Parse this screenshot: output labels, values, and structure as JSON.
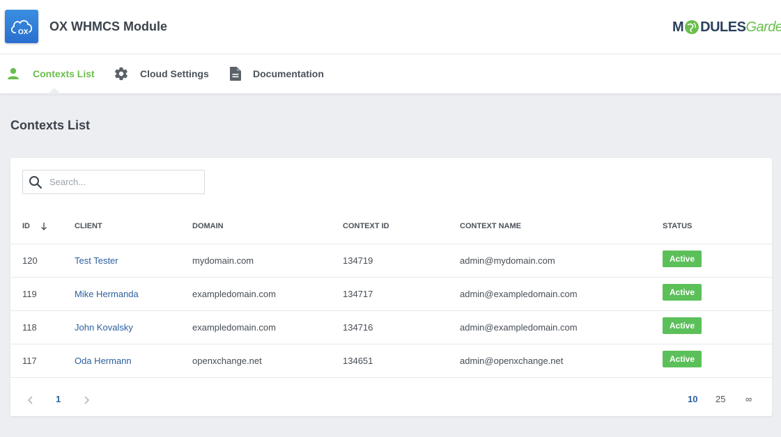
{
  "app": {
    "title": "OX WHMCS Module",
    "logo_text": "OX",
    "brand_part1": "M",
    "brand_part2": "DULES",
    "brand_part3": "Garden"
  },
  "nav": {
    "items": [
      {
        "label": "Contexts List",
        "icon": "user-icon",
        "active": true
      },
      {
        "label": "Cloud Settings",
        "icon": "gear-icon",
        "active": false
      },
      {
        "label": "Documentation",
        "icon": "document-icon",
        "active": false
      }
    ]
  },
  "page": {
    "title": "Contexts List"
  },
  "search": {
    "placeholder": "Search...",
    "value": ""
  },
  "table": {
    "columns": [
      "ID",
      "CLIENT",
      "DOMAIN",
      "CONTEXT ID",
      "CONTEXT NAME",
      "STATUS"
    ],
    "sort": {
      "column": "ID",
      "direction": "desc"
    },
    "rows": [
      {
        "id": "120",
        "client": "Test Tester",
        "domain": "mydomain.com",
        "context_id": "134719",
        "context_name": "admin@mydomain.com",
        "status": "Active"
      },
      {
        "id": "119",
        "client": "Mike Hermanda",
        "domain": "exampledomain.com",
        "context_id": "134717",
        "context_name": "admin@exampledomain.com",
        "status": "Active"
      },
      {
        "id": "118",
        "client": "John Kovalsky",
        "domain": "exampledomain.com",
        "context_id": "134716",
        "context_name": "admin@exampledomain.com",
        "status": "Active"
      },
      {
        "id": "117",
        "client": "Oda Hermann",
        "domain": "openxchange.net",
        "context_id": "134651",
        "context_name": "admin@openxchange.net",
        "status": "Active"
      }
    ]
  },
  "pagination": {
    "current_page": "1",
    "page_sizes": [
      "10",
      "25",
      "∞"
    ],
    "selected_page_size": "10"
  },
  "colors": {
    "accent_green": "#69be4c",
    "status_active": "#5cc05a",
    "link_blue": "#2b5f9e",
    "logo_blue": "#2a6fcf"
  }
}
